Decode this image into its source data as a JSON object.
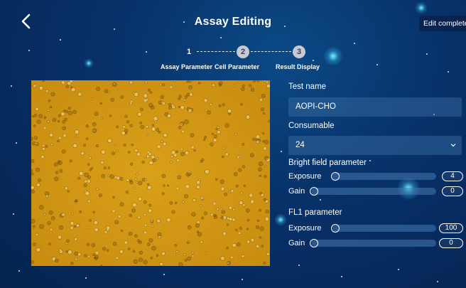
{
  "header": {
    "title": "Assay Editing",
    "edit_button_label": "Edit completed",
    "back_icon": "chevron-left-icon"
  },
  "stepper": {
    "steps": [
      {
        "number": "1",
        "label": "Assay Parameter",
        "state": "current"
      },
      {
        "number": "2",
        "label": "Cell Parameter",
        "state": "upcoming"
      },
      {
        "number": "3",
        "label": "Result Display",
        "state": "upcoming"
      }
    ]
  },
  "form": {
    "test_name_label": "Test name",
    "test_name_value": "AOPI-CHO",
    "consumable_label": "Consumable",
    "consumable_value": "24",
    "bright_field": {
      "section_label": "Bright field parameter",
      "exposure_label": "Exposure",
      "exposure_value": "4",
      "gain_label": "Gain",
      "gain_value": "0"
    },
    "fl1": {
      "section_label": "FL1 parameter",
      "exposure_label": "Exposure",
      "exposure_value": "100",
      "gain_label": "Gain",
      "gain_value": "0"
    }
  },
  "colors": {
    "background": "#08326a",
    "image_tint": "#cf9413",
    "input_bg": "#3c6ea5"
  }
}
